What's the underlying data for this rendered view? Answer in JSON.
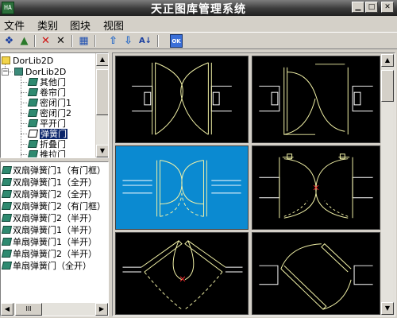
{
  "window": {
    "title": "天正图库管理系统",
    "app_icon": "HA",
    "controls": [
      "minimize-icon",
      "maximize-icon",
      "close-icon"
    ]
  },
  "menu": {
    "items": [
      "文件",
      "类别",
      "图块",
      "视图"
    ]
  },
  "toolbar": {
    "buttons": [
      {
        "icon": "new-category-icon",
        "glyph": "❖"
      },
      {
        "icon": "new-block-icon",
        "glyph": "▲"
      },
      {
        "icon": "delete-category-icon",
        "glyph": "✕"
      },
      {
        "icon": "delete-block-icon",
        "glyph": "✕"
      },
      {
        "icon": "layout-icon",
        "glyph": "▦"
      },
      {
        "icon": "move-up-icon",
        "glyph": "⇧"
      },
      {
        "icon": "move-down-icon",
        "glyph": "⇩"
      },
      {
        "icon": "sort-az-icon",
        "glyph": "A↓"
      },
      {
        "icon": "ok-icon",
        "glyph": "OK"
      }
    ]
  },
  "tree": {
    "root": "DorLib2D",
    "library": "DorLib2D",
    "categories": [
      "其他门",
      "卷帘门",
      "密闭门1",
      "密闭门2",
      "平开门",
      "弹簧门",
      "折叠门",
      "推拉门"
    ],
    "selected_index": 5
  },
  "list": {
    "items": [
      "双扇弹簧门1（有门框）",
      "双扇弹簧门1（全开）",
      "双扇弹簧门2（全开）",
      "双扇弹簧门2（有门框）",
      "双扇弹簧门2（半开）",
      "双扇弹簧门1（半开）",
      "单扇弹簧门1（半开）",
      "单扇弹簧门2（半开）",
      "单扇弹簧门（全开）"
    ],
    "scroll_glyph": "III"
  },
  "preview": {
    "selected_index": 2,
    "colors": {
      "background": "#000000",
      "selected": "#0b8ad1",
      "stroke": "#f3f3a8",
      "wall": "#ffffff",
      "marker": "#ff3030"
    }
  }
}
